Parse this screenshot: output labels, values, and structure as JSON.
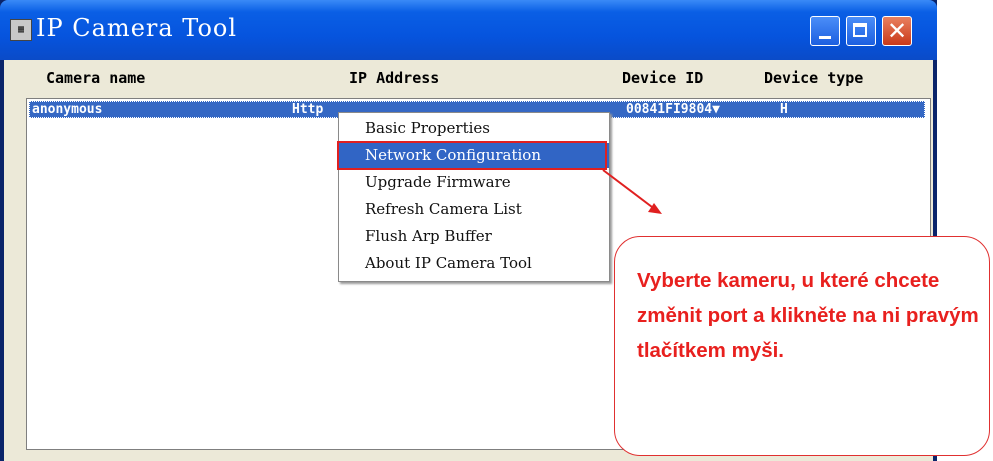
{
  "window": {
    "title": "IP Camera Tool",
    "icon": "app-icon",
    "controls": [
      "minimize-icon",
      "maximize-icon",
      "close-icon"
    ]
  },
  "table": {
    "headers": {
      "name": "Camera name",
      "ip": "IP Address",
      "device_id": "Device ID",
      "device_type": "Device type"
    },
    "rows": [
      {
        "name": "anonymous",
        "ip": "Http",
        "device_id": "00841FI9804▼",
        "device_type": "H"
      }
    ]
  },
  "context_menu": {
    "items": [
      {
        "label": "Basic Properties"
      },
      {
        "label": "Network Configuration"
      },
      {
        "label": "Upgrade Firmware"
      },
      {
        "label": "Refresh Camera List"
      },
      {
        "label": "Flush Arp Buffer"
      },
      {
        "label": "About IP Camera Tool"
      }
    ],
    "selected_index": 1
  },
  "annotation": {
    "text": "Vyberte kameru, u které chcete změnit port a klikněte na ni pravým tlačítkem myši.",
    "color": "#e8201e"
  },
  "colors": {
    "titlebar": "#0654de",
    "selection": "#3165c5",
    "highlight": "#e02020"
  }
}
